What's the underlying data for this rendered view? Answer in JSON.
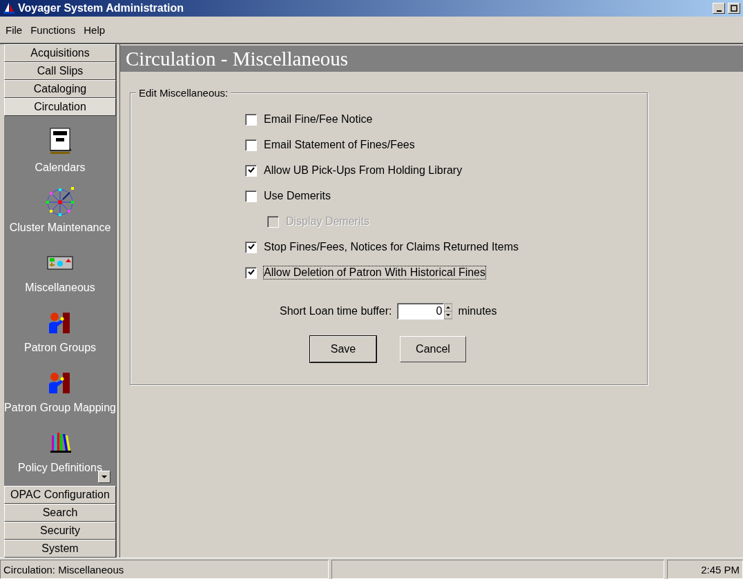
{
  "window": {
    "title": "Voyager System Administration"
  },
  "menu": [
    "File",
    "Functions",
    "Help"
  ],
  "sidebar": {
    "top_buttons": [
      {
        "label": "Acquisitions",
        "selected": false
      },
      {
        "label": "Call Slips",
        "selected": false
      },
      {
        "label": "Cataloging",
        "selected": false
      },
      {
        "label": "Circulation",
        "selected": true
      }
    ],
    "items": [
      {
        "label": "Calendars",
        "kind": "calendar"
      },
      {
        "label": "Cluster Maintenance",
        "kind": "cluster"
      },
      {
        "label": "Miscellaneous",
        "kind": "misc"
      },
      {
        "label": "Patron Groups",
        "kind": "patron"
      },
      {
        "label": "Patron Group Mapping",
        "kind": "patron"
      },
      {
        "label": "Policy Definitions",
        "kind": "books"
      }
    ],
    "bottom_buttons": [
      {
        "label": "OPAC Configuration",
        "selected": false
      },
      {
        "label": "Search",
        "selected": false
      },
      {
        "label": "Security",
        "selected": false
      },
      {
        "label": "System",
        "selected": false
      }
    ]
  },
  "page": {
    "title": "Circulation - Miscellaneous",
    "group": {
      "title": "Edit Miscellaneous:",
      "options": [
        {
          "label": "Email Fine/Fee Notice",
          "checked": false,
          "disabled": false,
          "indented": false,
          "focused": false
        },
        {
          "label": "Email Statement of Fines/Fees",
          "checked": false,
          "disabled": false,
          "indented": false,
          "focused": false
        },
        {
          "label": "Allow UB Pick-Ups From Holding Library",
          "checked": true,
          "disabled": false,
          "indented": false,
          "focused": false
        },
        {
          "label": "Use Demerits",
          "checked": false,
          "disabled": false,
          "indented": false,
          "focused": false
        },
        {
          "label": "Display Demerits",
          "checked": false,
          "disabled": true,
          "indented": true,
          "focused": false
        },
        {
          "label": "Stop Fines/Fees, Notices for Claims Returned Items",
          "checked": true,
          "disabled": false,
          "indented": false,
          "focused": false
        },
        {
          "label": "Allow Deletion of Patron With Historical Fines",
          "checked": true,
          "disabled": false,
          "indented": false,
          "focused": true
        }
      ],
      "buffer": {
        "label": "Short Loan time buffer:",
        "value": "0",
        "unit": "minutes"
      },
      "buttons": [
        {
          "label": "Save",
          "default": true
        },
        {
          "label": "Cancel",
          "default": false
        }
      ]
    }
  },
  "status_bar": {
    "text": "Circulation:  Miscellaneous",
    "time": "2:45 PM"
  }
}
